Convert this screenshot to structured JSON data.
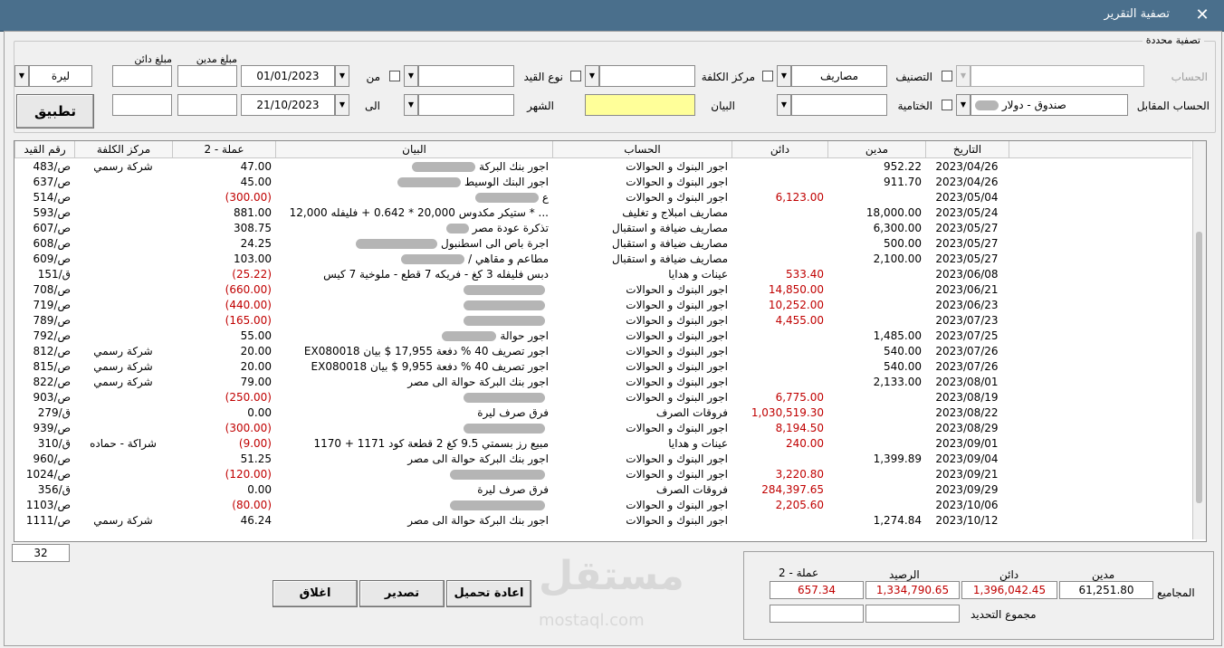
{
  "window": {
    "title": "تصفية التقرير",
    "close_icon": "close-icon"
  },
  "filter": {
    "caption": "تصفية محددة",
    "account_label": "الحساب",
    "account_value": "",
    "counter_account_label": "الحساب المقابل",
    "counter_account_value": "صندوق  - دولار",
    "classification_label": "التصنيف",
    "classification_value": "مصاريف",
    "closing_label": "الختامية",
    "closing_value": "",
    "cost_center_label": "مركز الكلفة",
    "cost_center_value": "",
    "statement_label": "البيان",
    "statement_value": "",
    "entry_type_label": "نوع القيد",
    "entry_type_value": "",
    "month_label": "الشهر",
    "month_value": "",
    "from_label": "من",
    "from_date": "01/01/2023",
    "to_label": "الى",
    "to_date": "21/10/2023",
    "debit_amount_label": "مبلغ مدين",
    "debit_amount_from": "",
    "debit_amount_to": "",
    "credit_amount_label": "مبلغ دائن",
    "credit_amount_from": "",
    "credit_amount_to": "",
    "currency_value": "ليرة",
    "apply_label": "تطبيق"
  },
  "table": {
    "columns": {
      "entry_no": "رقم القيد",
      "cost_center": "مركز الكلفة",
      "currency2": "عملة - 2",
      "statement": "البيان",
      "account": "الحساب",
      "credit": "دائن",
      "debit": "مدين",
      "date": "التاريخ"
    },
    "rows": [
      {
        "entry_no": "ص/483",
        "cost_center": "شركة رسمي",
        "currency2": "47.00",
        "currency2_neg": false,
        "statement": "اجور بنك البركة",
        "blur": 70,
        "account": "اجور البنوك و الحوالات",
        "credit": "",
        "debit": "952.22",
        "date": "2023/04/26"
      },
      {
        "entry_no": "ص/637",
        "cost_center": "",
        "currency2": "45.00",
        "currency2_neg": false,
        "statement": "اجور البنك الوسيط",
        "blur": 70,
        "account": "اجور البنوك و الحوالات",
        "credit": "",
        "debit": "911.70",
        "date": "2023/04/26"
      },
      {
        "entry_no": "ص/514",
        "cost_center": "",
        "currency2": "(300.00)",
        "currency2_neg": true,
        "statement": "ع",
        "blur": 70,
        "account": "اجور البنوك و الحوالات",
        "credit": "6,123.00",
        "debit": "",
        "date": "2023/05/04"
      },
      {
        "entry_no": "ص/593",
        "cost_center": "",
        "currency2": "881.00",
        "currency2_neg": false,
        "statement": "... * ستيكر مكدوس 20,000 * 0.642 + فليفله 12,000",
        "blur": 0,
        "account": "مصاريف امبلاج و تغليف",
        "credit": "",
        "debit": "18,000.00",
        "date": "2023/05/24"
      },
      {
        "entry_no": "ص/607",
        "cost_center": "",
        "currency2": "308.75",
        "currency2_neg": false,
        "statement": "تذكرة عودة مصر",
        "blur": 25,
        "account": "مصاريف ضيافة و استقبال",
        "credit": "",
        "debit": "6,300.00",
        "date": "2023/05/27"
      },
      {
        "entry_no": "ص/608",
        "cost_center": "",
        "currency2": "24.25",
        "currency2_neg": false,
        "statement": "اجرة باص الى اسطنبول",
        "blur": 90,
        "account": "مصاريف ضيافة و استقبال",
        "credit": "",
        "debit": "500.00",
        "date": "2023/05/27"
      },
      {
        "entry_no": "ص/609",
        "cost_center": "",
        "currency2": "103.00",
        "currency2_neg": false,
        "statement": "مطاعم و مقاهي /",
        "blur": 70,
        "account": "مصاريف ضيافة و استقبال",
        "credit": "",
        "debit": "2,100.00",
        "date": "2023/05/27"
      },
      {
        "entry_no": "ق/151",
        "cost_center": "",
        "currency2": "(25.22)",
        "currency2_neg": true,
        "statement": "دبس فليفله 3 كغ - فريكه 7 قطع - ملوخية 7 كيس",
        "blur": 0,
        "account": "عينات و هدايا",
        "credit": "533.40",
        "debit": "",
        "date": "2023/06/08"
      },
      {
        "entry_no": "ص/708",
        "cost_center": "",
        "currency2": "(660.00)",
        "currency2_neg": true,
        "statement": "",
        "blur": 90,
        "account": "اجور البنوك و الحوالات",
        "credit": "14,850.00",
        "debit": "",
        "date": "2023/06/21"
      },
      {
        "entry_no": "ص/719",
        "cost_center": "",
        "currency2": "(440.00)",
        "currency2_neg": true,
        "statement": "",
        "blur": 90,
        "account": "اجور البنوك و الحوالات",
        "credit": "10,252.00",
        "debit": "",
        "date": "2023/06/23"
      },
      {
        "entry_no": "ص/789",
        "cost_center": "",
        "currency2": "(165.00)",
        "currency2_neg": true,
        "statement": "",
        "blur": 90,
        "account": "اجور البنوك و الحوالات",
        "credit": "4,455.00",
        "debit": "",
        "date": "2023/07/23"
      },
      {
        "entry_no": "ص/792",
        "cost_center": "",
        "currency2": "55.00",
        "currency2_neg": false,
        "statement": "اجور حوالة",
        "blur": 60,
        "account": "اجور البنوك و الحوالات",
        "credit": "",
        "debit": "1,485.00",
        "date": "2023/07/25"
      },
      {
        "entry_no": "ص/812",
        "cost_center": "شركة رسمي",
        "currency2": "20.00",
        "currency2_neg": false,
        "statement": "اجور تصريف 40 % دفعة 17,955 $ بيان EX080018",
        "blur": 0,
        "account": "اجور البنوك و الحوالات",
        "credit": "",
        "debit": "540.00",
        "date": "2023/07/26"
      },
      {
        "entry_no": "ص/815",
        "cost_center": "شركة رسمي",
        "currency2": "20.00",
        "currency2_neg": false,
        "statement": "اجور تصريف 40 % دفعة 9,955 $ بيان EX080018",
        "blur": 0,
        "account": "اجور البنوك و الحوالات",
        "credit": "",
        "debit": "540.00",
        "date": "2023/07/26"
      },
      {
        "entry_no": "ص/822",
        "cost_center": "شركة رسمي",
        "currency2": "79.00",
        "currency2_neg": false,
        "statement": "اجور بنك البركة حوالة الى مصر",
        "blur": 0,
        "account": "اجور البنوك و الحوالات",
        "credit": "",
        "debit": "2,133.00",
        "date": "2023/08/01"
      },
      {
        "entry_no": "ص/903",
        "cost_center": "",
        "currency2": "(250.00)",
        "currency2_neg": true,
        "statement": "",
        "blur": 90,
        "account": "اجور البنوك و الحوالات",
        "credit": "6,775.00",
        "debit": "",
        "date": "2023/08/19"
      },
      {
        "entry_no": "ق/279",
        "cost_center": "",
        "currency2": "0.00",
        "currency2_neg": false,
        "statement": "فرق صرف ليرة",
        "blur": 0,
        "account": "فروقات الصرف",
        "credit": "1,030,519.30",
        "debit": "",
        "date": "2023/08/22"
      },
      {
        "entry_no": "ص/939",
        "cost_center": "",
        "currency2": "(300.00)",
        "currency2_neg": true,
        "statement": "",
        "blur": 90,
        "account": "اجور البنوك و الحوالات",
        "credit": "8,194.50",
        "debit": "",
        "date": "2023/08/29"
      },
      {
        "entry_no": "ق/310",
        "cost_center": "شراكة - حماده",
        "currency2": "(9.00)",
        "currency2_neg": true,
        "statement": "مبيع رز بسمتي 9.5 كغ 2 قطعة كود 1171 + 1170",
        "blur": 0,
        "account": "عينات و هدايا",
        "credit": "240.00",
        "debit": "",
        "date": "2023/09/01"
      },
      {
        "entry_no": "ص/960",
        "cost_center": "",
        "currency2": "51.25",
        "currency2_neg": false,
        "statement": "اجور بنك البركة حوالة الى مصر",
        "blur": 0,
        "account": "اجور البنوك و الحوالات",
        "credit": "",
        "debit": "1,399.89",
        "date": "2023/09/04"
      },
      {
        "entry_no": "ص/1024",
        "cost_center": "",
        "currency2": "(120.00)",
        "currency2_neg": true,
        "statement": "",
        "blur": 105,
        "account": "اجور البنوك و الحوالات",
        "credit": "3,220.80",
        "debit": "",
        "date": "2023/09/21"
      },
      {
        "entry_no": "ق/356",
        "cost_center": "",
        "currency2": "0.00",
        "currency2_neg": false,
        "statement": "فرق صرف ليرة",
        "blur": 0,
        "account": "فروقات الصرف",
        "credit": "284,397.65",
        "debit": "",
        "date": "2023/09/29"
      },
      {
        "entry_no": "ص/1103",
        "cost_center": "",
        "currency2": "(80.00)",
        "currency2_neg": true,
        "statement": "",
        "blur": 105,
        "account": "اجور البنوك و الحوالات",
        "credit": "2,205.60",
        "debit": "",
        "date": "2023/10/06"
      },
      {
        "entry_no": "ص/1111",
        "cost_center": "شركة رسمي",
        "currency2": "46.24",
        "currency2_neg": false,
        "statement": "اجور بنك البركة حوالة الى مصر",
        "blur": 0,
        "account": "اجور البنوك و الحوالات",
        "credit": "",
        "debit": "1,274.84",
        "date": "2023/10/12"
      }
    ],
    "row_count": "32"
  },
  "buttons": {
    "reload": "اعادة تحميل",
    "export": "تصدير",
    "close": "اغلاق"
  },
  "totals": {
    "label": "المجاميع",
    "debit_label": "مدين",
    "credit_label": "دائن",
    "balance_label": "الرصيد",
    "currency2_label": "عملة - 2",
    "debit": "61,251.80",
    "credit": "1,396,042.45",
    "balance": "1,334,790.65",
    "currency2": "657.34",
    "selection_label": "مجموع التحديد",
    "selection_a": "",
    "selection_b": ""
  },
  "watermark": {
    "text": "مستقل",
    "url_text": "mostaql.com"
  },
  "colors": {
    "titlebar": "#4a6f8c",
    "negative": "#c00000",
    "highlight_field": "#ffff99"
  }
}
